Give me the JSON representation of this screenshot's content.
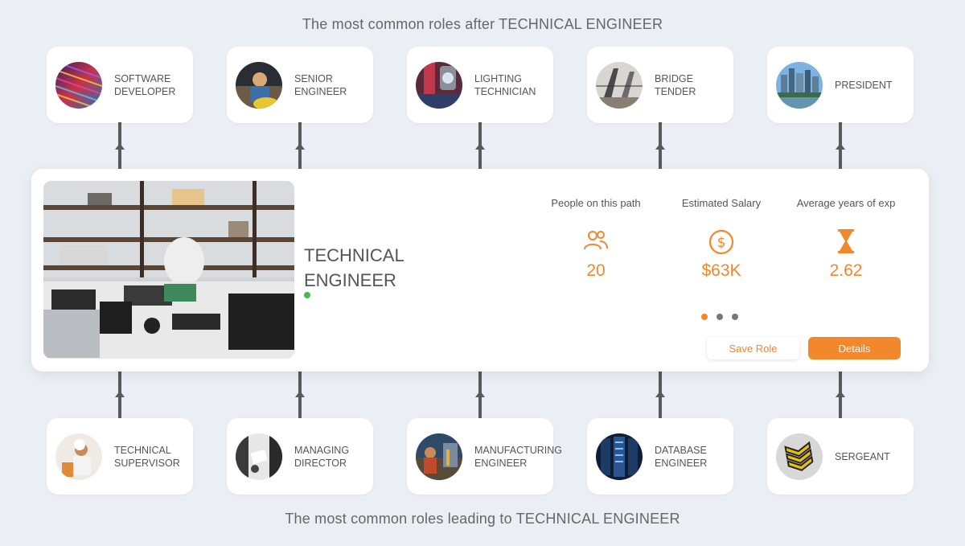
{
  "headings": {
    "top": "The most common roles after TECHNICAL ENGINEER",
    "bottom": "The most common roles leading to TECHNICAL ENGINEER"
  },
  "next_roles": [
    {
      "line1": "SOFTWARE",
      "line2": "DEVELOPER",
      "icon": "colorful-cables-photo"
    },
    {
      "line1": "SENIOR",
      "line2": "ENGINEER",
      "icon": "engineer-at-work-photo"
    },
    {
      "line1": "LIGHTING",
      "line2": "TECHNICIAN",
      "icon": "stage-lights-photo"
    },
    {
      "line1": "BRIDGE",
      "line2": "TENDER",
      "icon": "bridge-photo"
    },
    {
      "line1": "PRESIDENT",
      "line2": "",
      "icon": "city-skyline-photo"
    }
  ],
  "previous_roles": [
    {
      "line1": "TECHNICAL",
      "line2": "SUPERVISOR",
      "icon": "supervisor-photo"
    },
    {
      "line1": "MANAGING",
      "line2": "DIRECTOR",
      "icon": "meeting-photo"
    },
    {
      "line1": "MANUFACTURING",
      "line2": "ENGINEER",
      "icon": "factory-photo"
    },
    {
      "line1": "DATABASE",
      "line2": "ENGINEER",
      "icon": "server-room-photo"
    },
    {
      "line1": "SERGEANT",
      "line2": "",
      "icon": "sergeant-chevron-badge"
    }
  ],
  "current_role": {
    "title_line1": "TECHNICAL",
    "title_line2": "ENGINEER",
    "photo": "electronics-workbench-photo",
    "status_color": "#4cb84c"
  },
  "stats": [
    {
      "label": "People on this path",
      "value": "20",
      "icon": "people-icon"
    },
    {
      "label": "Estimated Salary",
      "value": "$63K",
      "icon": "dollar-icon"
    },
    {
      "label": "Average years of exp",
      "value": "2.62",
      "icon": "hourglass-icon"
    }
  ],
  "carousel": {
    "count": 3,
    "active": 0
  },
  "buttons": {
    "save": "Save Role",
    "details": "Details"
  },
  "colors": {
    "accent": "#f2872b",
    "background": "#eceef5",
    "connector": "#5a5a5a"
  }
}
